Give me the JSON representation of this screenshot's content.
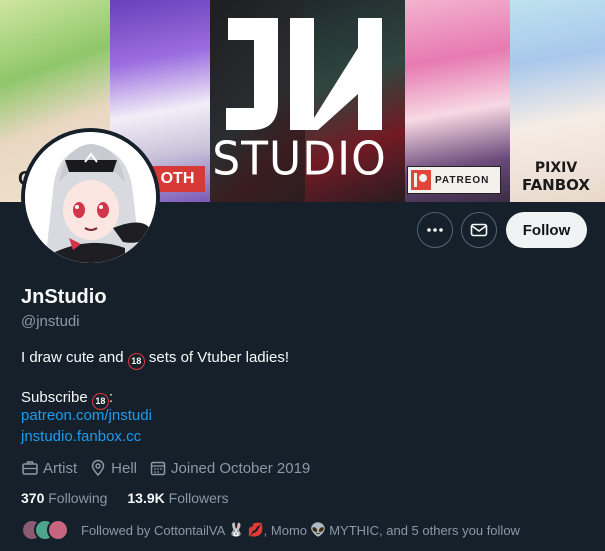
{
  "banner": {
    "logo_text": "JN",
    "studio_text": "STUDIO",
    "patreon_label": "PATREON",
    "fanbox_line1": "PIXIV",
    "fanbox_line2": "FANBOX",
    "oth_text": "OTH",
    "left_letter": "C"
  },
  "actions": {
    "more_icon": "more-horizontal-icon",
    "message_icon": "envelope-icon",
    "follow_label": "Follow"
  },
  "profile": {
    "name": "JnStudio",
    "handle": "@jnstudi",
    "bio_part1": "I draw cute and",
    "bio_badge": "18",
    "bio_part2": "sets of Vtuber ladies!",
    "subscribe_label": "Subscribe",
    "subscribe_badge": "18",
    "subscribe_colon": ":",
    "link1": "patreon.com/jnstudi",
    "link2": "jnstudio.fanbox.cc"
  },
  "meta": {
    "category": "Artist",
    "location": "Hell",
    "joined": "Joined October 2019"
  },
  "counts": {
    "following_value": "370",
    "following_label": "Following",
    "followers_value": "13.9K",
    "followers_label": "Followers"
  },
  "followed_by": {
    "prefix": "Followed by CottontailVA",
    "emoji1": "🐰",
    "emoji2": "💋",
    "middle": ", Momo",
    "emoji3": "👽",
    "suffix": "MYTHIC, and 5 others you follow"
  },
  "colors": {
    "background": "#15202b",
    "link": "#1d9bf0",
    "muted": "#8b98a5",
    "follow_bg": "#eff3f4"
  }
}
